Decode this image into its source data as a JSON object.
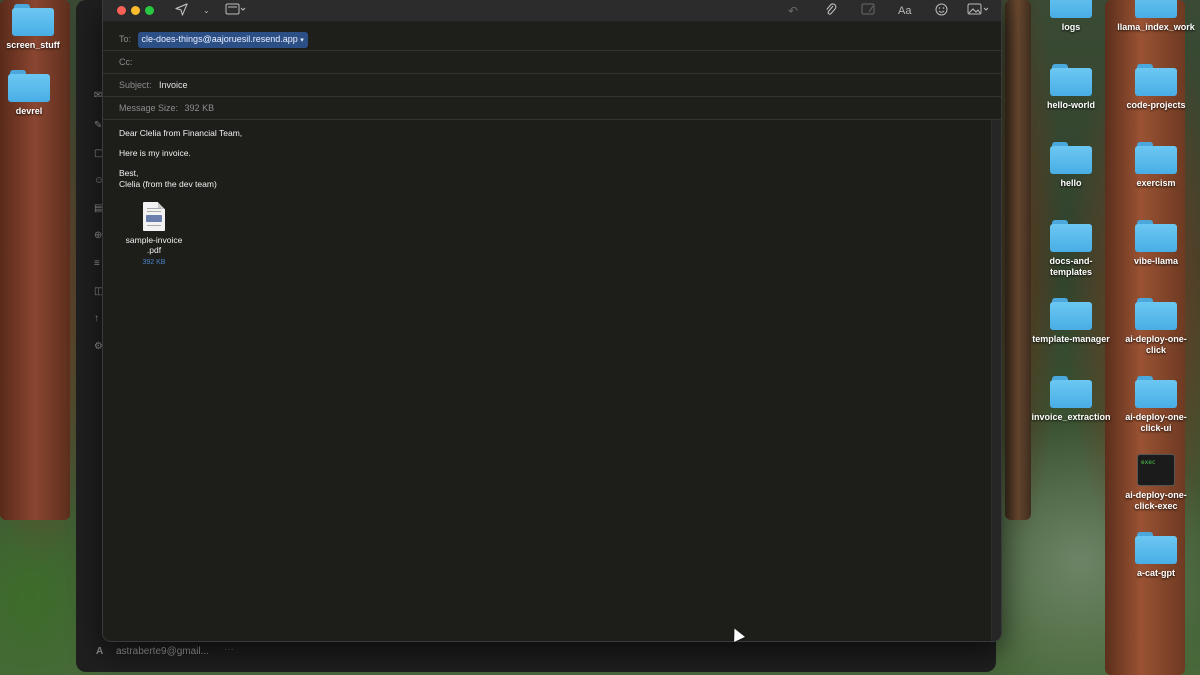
{
  "desktop": {
    "left_icons": [
      {
        "label": "screen_stuff",
        "icon": "folder-icon"
      },
      {
        "label": "devrel",
        "icon": "folder-icon"
      }
    ],
    "right_icons": [
      {
        "label": "logs",
        "icon": "folder-icon"
      },
      {
        "label": "llama_index_work",
        "icon": "folder-icon"
      },
      {
        "label": "hello-world",
        "icon": "folder-icon"
      },
      {
        "label": "code-projects",
        "icon": "folder-icon"
      },
      {
        "label": "hello",
        "icon": "folder-icon"
      },
      {
        "label": "exercism",
        "icon": "folder-icon"
      },
      {
        "label": "docs-and-templates",
        "icon": "folder-icon"
      },
      {
        "label": "vibe-llama",
        "icon": "folder-icon"
      },
      {
        "label": "template-manager",
        "icon": "folder-icon"
      },
      {
        "label": "ai-deploy-one-click",
        "icon": "folder-icon"
      },
      {
        "label": "invoice_extraction",
        "icon": "folder-icon"
      },
      {
        "label": "ai-deploy-one-click-ui",
        "icon": "folder-icon"
      },
      {
        "label": "ai-deploy-one-click-exec",
        "icon": "exec-file-icon",
        "thumb_text": "exec"
      },
      {
        "label": "a-cat-gpt",
        "icon": "folder-icon"
      }
    ]
  },
  "background_mail": {
    "account_initial": "A",
    "account_email": "astraberte9@gmail..."
  },
  "compose": {
    "toolbar": {
      "send_icon": "send-icon",
      "send_options_icon": "chevron-down-icon",
      "header_fields_icon": "header-fields-icon",
      "reply_icon": "reply-icon",
      "attach_icon": "paperclip-icon",
      "markup_icon": "markup-icon",
      "format_label": "Aa",
      "emoji_icon": "emoji-icon",
      "photo_browser_icon": "photo-browser-icon"
    },
    "to": {
      "label": "To:",
      "value": "cle-does-things@aajoruesil.resend.app"
    },
    "cc": {
      "label": "Cc:",
      "value": ""
    },
    "subject": {
      "label": "Subject:",
      "value": "Invoice"
    },
    "message_size": {
      "label": "Message Size:",
      "value": "392 KB"
    },
    "body": {
      "greeting": "Dear Clelia from Financial Team,",
      "line1": "Here is my invoice.",
      "signoff": "Best,",
      "signature": "Clelia (from the dev team)"
    },
    "attachment": {
      "name_line1": "sample-invoice",
      "name_line2": ".pdf",
      "size": "392 KB"
    }
  },
  "colors": {
    "accent": "#2c4f86",
    "folder": "#5bb8ee",
    "link_blue": "#4a84c8"
  }
}
